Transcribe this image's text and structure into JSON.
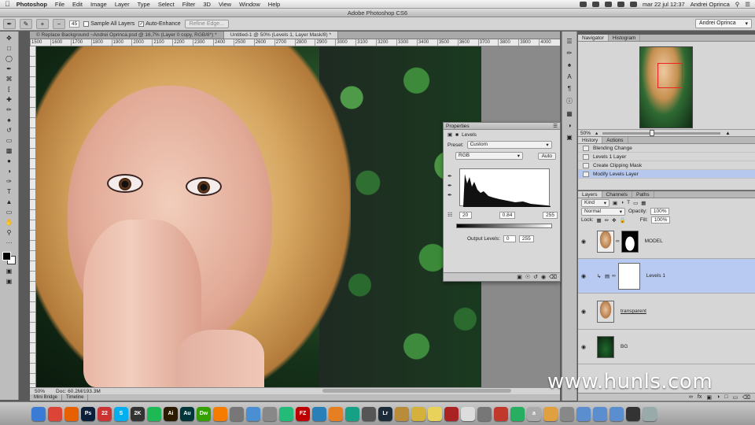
{
  "menubar": {
    "apple": "",
    "items": [
      "Photoshop",
      "File",
      "Edit",
      "Image",
      "Layer",
      "Type",
      "Select",
      "Filter",
      "3D",
      "View",
      "Window",
      "Help"
    ],
    "clock": "mar 22 jul  12:37",
    "user": "Andrei Oprinca"
  },
  "window": {
    "title": "Adobe Photoshop CS6"
  },
  "options": {
    "brush_size": "45",
    "sample_all": "Sample All Layers",
    "auto_enhance": "Auto-Enhance",
    "refine_edge": "Refine Edge...",
    "workspace": "Andrei Oprinca"
  },
  "tabs": [
    {
      "label": "© Replace Background ~Andrei Oprinca.psd @ 16,7% (Layer 0 copy, RGB/8*) *",
      "active": false
    },
    {
      "label": "Untitled-1 @ 50% (Levels 1, Layer Mask/8) *",
      "active": true
    }
  ],
  "ruler": [
    "1500",
    "1600",
    "1700",
    "1800",
    "1900",
    "2000",
    "2100",
    "2200",
    "2300",
    "2400",
    "2500",
    "2600",
    "2700",
    "2800",
    "2900",
    "3000",
    "3100",
    "3200",
    "3300",
    "3400",
    "3500",
    "3600",
    "3700",
    "3800",
    "3900",
    "4000"
  ],
  "status": {
    "zoom": "50%",
    "doc": "Doc: 60.2M/193.3M"
  },
  "bottom_tabs": [
    "Mini Bridge",
    "Timeline"
  ],
  "properties": {
    "tab": "Properties",
    "title": "Levels",
    "preset_label": "Preset:",
    "preset_value": "Custom",
    "channel": "RGB",
    "auto": "Auto",
    "input_black": "20",
    "input_mid": "0.84",
    "input_white": "255",
    "output_label": "Output Levels:",
    "output_black": "0",
    "output_white": "255"
  },
  "navigator": {
    "tabs": [
      "Navigator",
      "Histogram"
    ],
    "zoom": "50%"
  },
  "history": {
    "tabs": [
      "History",
      "Actions"
    ],
    "items": [
      {
        "label": "Blending Change",
        "selected": false
      },
      {
        "label": "Levels 1 Layer",
        "selected": false
      },
      {
        "label": "Create Clipping Mask",
        "selected": false
      },
      {
        "label": "Modify Levels Layer",
        "selected": true
      }
    ]
  },
  "layers": {
    "tabs": [
      "Layers",
      "Channels",
      "Paths"
    ],
    "kind": "Kind",
    "blend": "Normal",
    "opacity_label": "Opacity:",
    "opacity": "100%",
    "lock_label": "Lock:",
    "fill_label": "Fill:",
    "fill": "100%",
    "items": [
      {
        "name": "MODEL",
        "selected": false
      },
      {
        "name": "Levels 1",
        "selected": true
      },
      {
        "name": "transparent",
        "selected": false
      },
      {
        "name": "BG",
        "selected": false
      }
    ]
  },
  "watermark": "www.hunls.com",
  "dock": [
    {
      "name": "finder",
      "color": "#3a7bd5",
      "label": ""
    },
    {
      "name": "chrome",
      "color": "#db4437",
      "label": ""
    },
    {
      "name": "firefox",
      "color": "#e66000",
      "label": ""
    },
    {
      "name": "photoshop",
      "color": "#0b1e3a",
      "label": "Ps"
    },
    {
      "name": "calendar",
      "color": "#c33",
      "label": "22"
    },
    {
      "name": "skype",
      "color": "#00aff0",
      "label": "S"
    },
    {
      "name": "app-2k",
      "color": "#333",
      "label": "2K"
    },
    {
      "name": "spotify",
      "color": "#1db954",
      "label": ""
    },
    {
      "name": "illustrator",
      "color": "#2b1a00",
      "label": "Ai"
    },
    {
      "name": "audition",
      "color": "#00363a",
      "label": "Au"
    },
    {
      "name": "dreamweaver",
      "color": "#35a100",
      "label": "Dw"
    },
    {
      "name": "vlc",
      "color": "#f57c00",
      "label": ""
    },
    {
      "name": "app-folder",
      "color": "#777",
      "label": ""
    },
    {
      "name": "app-globe",
      "color": "#4a8fd1",
      "label": ""
    },
    {
      "name": "app-disk",
      "color": "#888",
      "label": ""
    },
    {
      "name": "app-monitor",
      "color": "#2b7",
      "label": ""
    },
    {
      "name": "filezilla",
      "color": "#bf0000",
      "label": "FZ"
    },
    {
      "name": "app-blue",
      "color": "#2980b9",
      "label": ""
    },
    {
      "name": "app-orange",
      "color": "#e67e22",
      "label": ""
    },
    {
      "name": "app-pattern",
      "color": "#16a085",
      "label": ""
    },
    {
      "name": "app-image",
      "color": "#555",
      "label": ""
    },
    {
      "name": "lightroom",
      "color": "#1c2b3a",
      "label": "Lr"
    },
    {
      "name": "app-box",
      "color": "#b98c3a",
      "label": ""
    },
    {
      "name": "app-notes",
      "color": "#d4b13a",
      "label": ""
    },
    {
      "name": "app-stickies",
      "color": "#e9d25a",
      "label": ""
    },
    {
      "name": "app-film",
      "color": "#a22",
      "label": ""
    },
    {
      "name": "app-paper",
      "color": "#ddd",
      "label": ""
    },
    {
      "name": "app-tools",
      "color": "#777",
      "label": ""
    },
    {
      "name": "app-target",
      "color": "#c0392b",
      "label": ""
    },
    {
      "name": "app-green",
      "color": "#27ae60",
      "label": ""
    },
    {
      "name": "app-a",
      "color": "#aaa",
      "label": "a"
    },
    {
      "name": "app-doc",
      "color": "#e0a040",
      "label": ""
    },
    {
      "name": "app-archive",
      "color": "#888",
      "label": ""
    },
    {
      "name": "downloads",
      "color": "#5b8ecf",
      "label": ""
    },
    {
      "name": "documents",
      "color": "#5b8ecf",
      "label": ""
    },
    {
      "name": "applications",
      "color": "#5b8ecf",
      "label": ""
    },
    {
      "name": "app-clock",
      "color": "#333",
      "label": ""
    },
    {
      "name": "trash",
      "color": "#9aa",
      "label": ""
    }
  ]
}
